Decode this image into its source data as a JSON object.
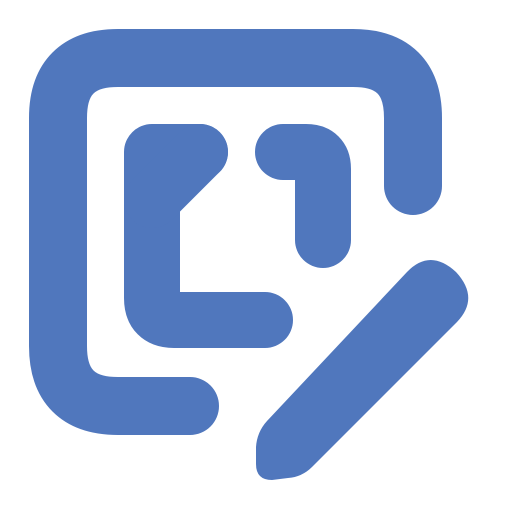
{
  "icon": {
    "name": "edit-document-icon",
    "color": "#5077bd",
    "background": "#ffffff"
  }
}
